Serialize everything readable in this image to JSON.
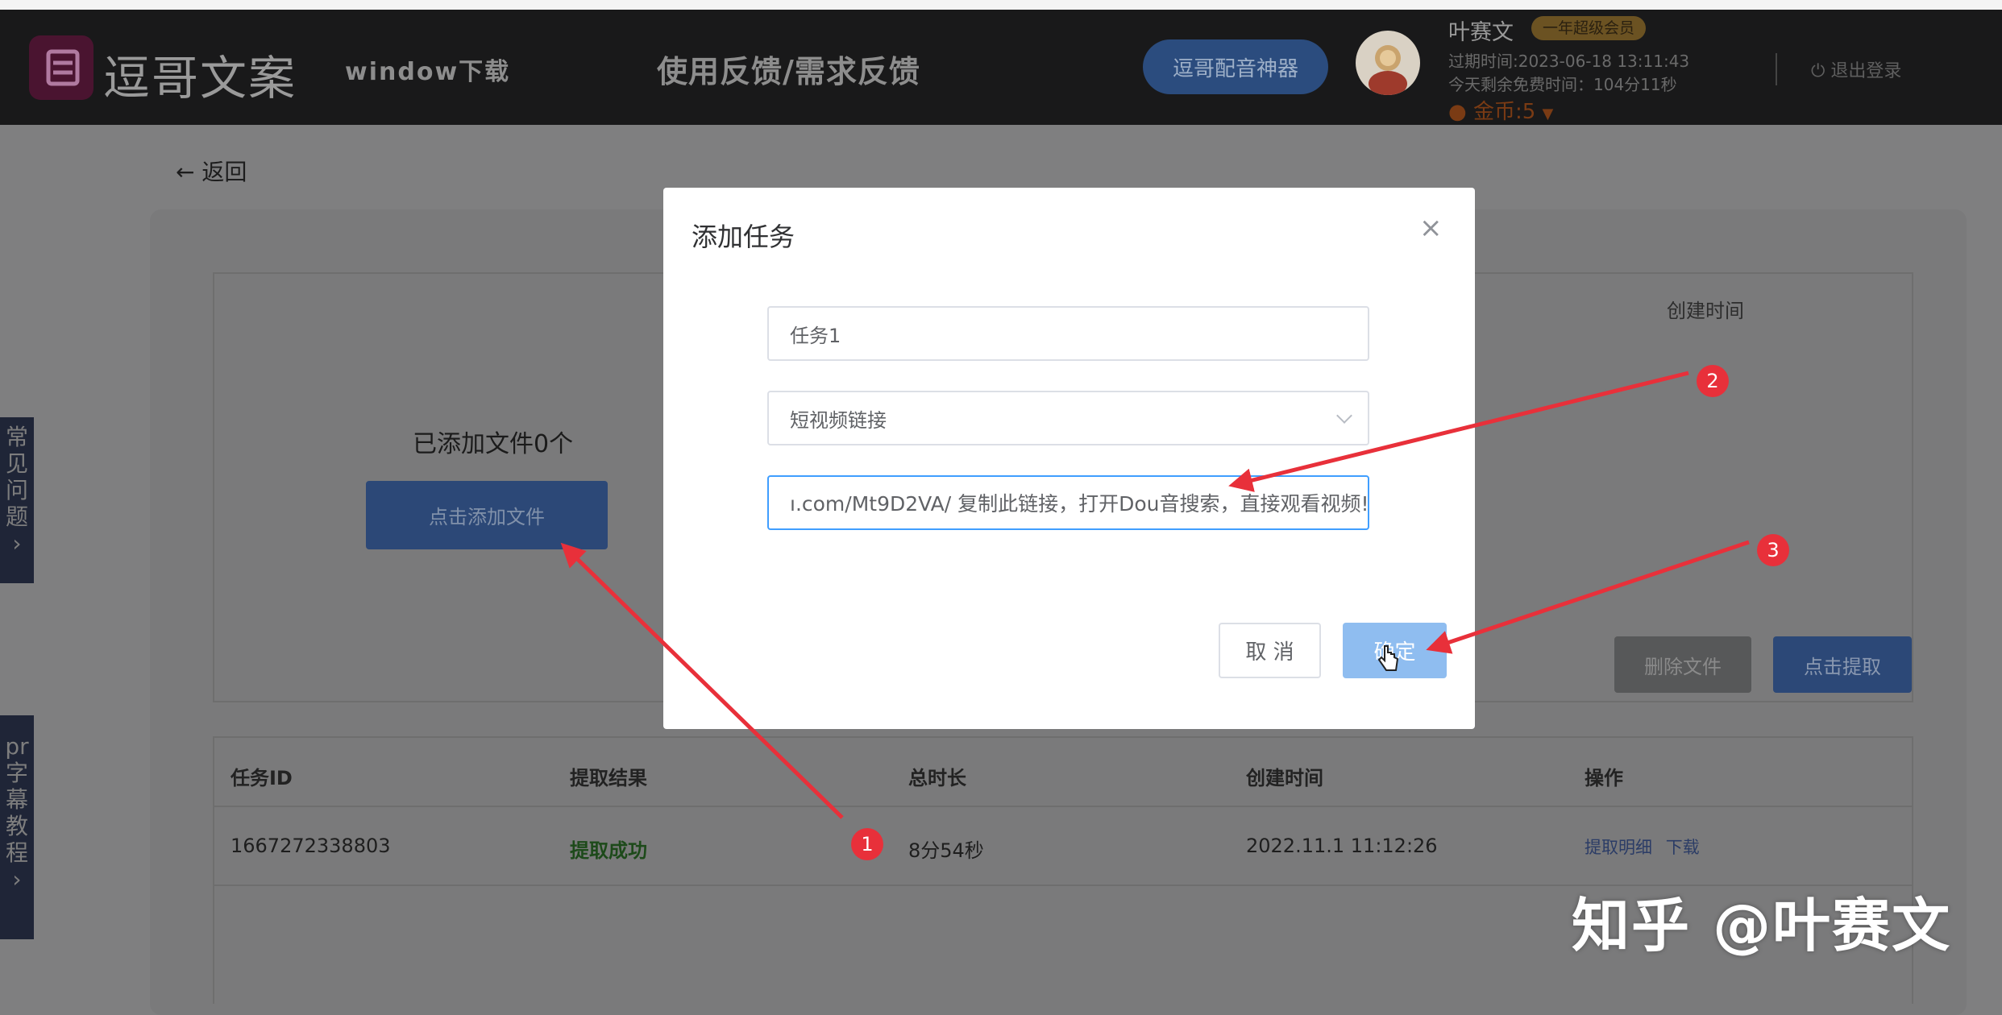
{
  "navbar": {
    "logo_text": "逗哥文案",
    "window_download": "window下载",
    "feedback": "使用反馈/需求反馈",
    "dub_button": "逗哥配音神器",
    "user_name": "叶赛文",
    "member_badge": "一年超级会员",
    "expire": "过期时间:2023-06-18 13:11:43",
    "remaining": "今天剩余免费时间：104分11秒",
    "coins": "金币:5",
    "logout": "退出登录"
  },
  "page": {
    "back": "返回",
    "upload_column_header": "创建时间",
    "added_files": "已添加文件0个",
    "add_file_button": "点击添加文件",
    "delete_file_button": "删除文件",
    "extract_button": "点击提取"
  },
  "table": {
    "headers": [
      "任务ID",
      "提取结果",
      "总时长",
      "创建时间",
      "操作"
    ],
    "rows": [
      {
        "id": "1667272338803",
        "result": "提取成功",
        "duration": "8分54秒",
        "created": "2022.11.1 11:12:26",
        "op_detail": "提取明细",
        "op_download": "下载"
      }
    ]
  },
  "side_tabs": {
    "faq": [
      "常",
      "见",
      "问",
      "题",
      "›"
    ],
    "pr": [
      "pr",
      "字",
      "幕",
      "教",
      "程",
      "›"
    ]
  },
  "modal": {
    "title": "添加任务",
    "close": "×",
    "task_name": "任务1",
    "source_type": "短视频链接",
    "link_value": "ı.com/Mt9D2VA/ 复制此链接，打开Dou音搜索，直接观看视频!",
    "cancel": "取 消",
    "confirm": "确定"
  },
  "annotations": {
    "marker_1": "1",
    "marker_2": "2",
    "marker_3": "3",
    "arrow_color": "#e8303a"
  },
  "watermark": "知乎 @叶赛文",
  "colors": {
    "navbar_bg": "#19191a",
    "primary": "#409eff",
    "overlay_bg": "#7f7f80"
  }
}
